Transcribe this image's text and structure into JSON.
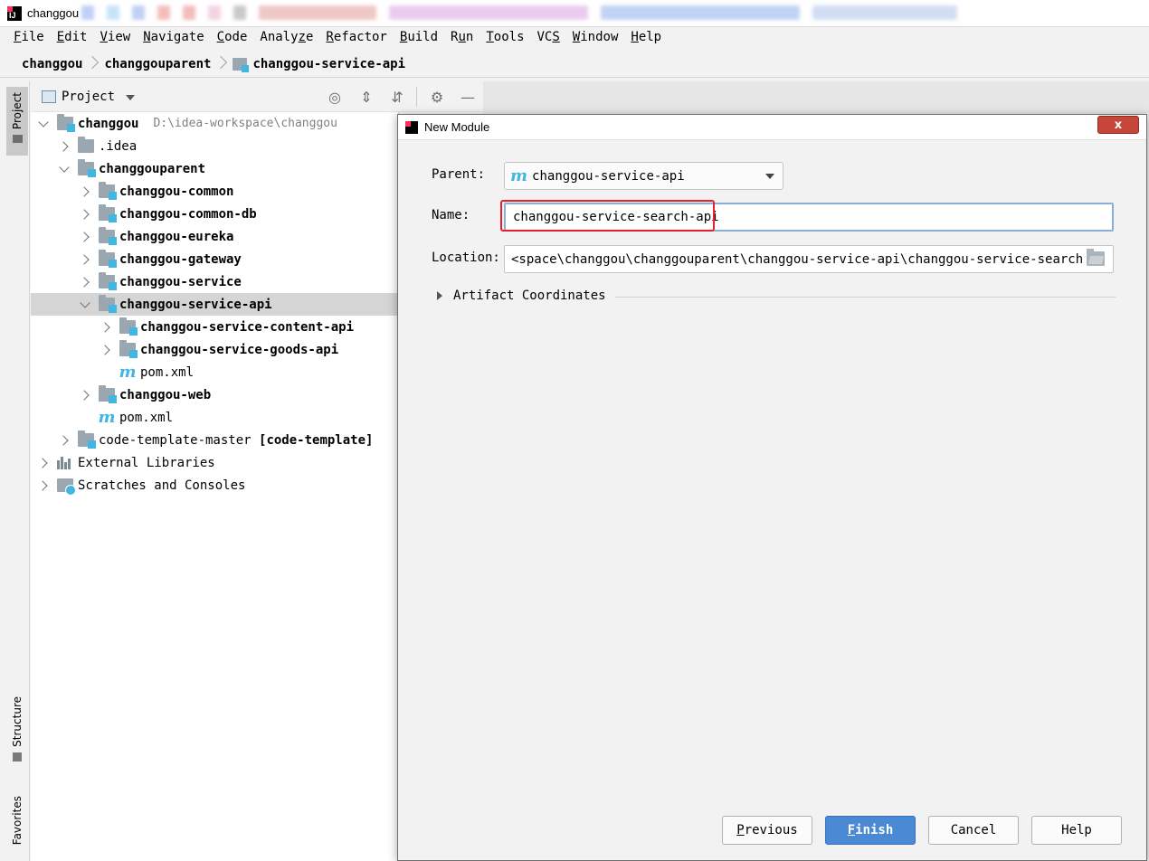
{
  "window": {
    "title": "changgou"
  },
  "menubar": [
    {
      "label": "File",
      "mnemonic": "F"
    },
    {
      "label": "Edit",
      "mnemonic": "E"
    },
    {
      "label": "View",
      "mnemonic": "V"
    },
    {
      "label": "Navigate",
      "mnemonic": "N"
    },
    {
      "label": "Code",
      "mnemonic": "C"
    },
    {
      "label": "Analyze",
      "mnemonic": "z"
    },
    {
      "label": "Refactor",
      "mnemonic": "R"
    },
    {
      "label": "Build",
      "mnemonic": "B"
    },
    {
      "label": "Run",
      "mnemonic": "u"
    },
    {
      "label": "Tools",
      "mnemonic": "T"
    },
    {
      "label": "VCS",
      "mnemonic": "S"
    },
    {
      "label": "Window",
      "mnemonic": "W"
    },
    {
      "label": "Help",
      "mnemonic": "H"
    }
  ],
  "breadcrumb": [
    "changgou",
    "changgouparent",
    "changgou-service-api"
  ],
  "left_stripe": {
    "project": "Project",
    "structure": "Structure",
    "favorites": "Favorites"
  },
  "project_panel": {
    "title": "Project",
    "tree": [
      {
        "label": "changgou",
        "path": "D:\\idea-workspace\\changgou",
        "depth": 0,
        "arrow": "down",
        "icon": "module",
        "bold": true
      },
      {
        "label": ".idea",
        "depth": 1,
        "arrow": "right",
        "icon": "folder"
      },
      {
        "label": "changgouparent",
        "depth": 1,
        "arrow": "down",
        "icon": "module",
        "bold": true
      },
      {
        "label": "changgou-common",
        "depth": 2,
        "arrow": "right",
        "icon": "module",
        "bold": true
      },
      {
        "label": "changgou-common-db",
        "depth": 2,
        "arrow": "right",
        "icon": "module",
        "bold": true
      },
      {
        "label": "changgou-eureka",
        "depth": 2,
        "arrow": "right",
        "icon": "module",
        "bold": true
      },
      {
        "label": "changgou-gateway",
        "depth": 2,
        "arrow": "right",
        "icon": "module",
        "bold": true
      },
      {
        "label": "changgou-service",
        "depth": 2,
        "arrow": "right",
        "icon": "module",
        "bold": true
      },
      {
        "label": "changgou-service-api",
        "depth": 2,
        "arrow": "down",
        "icon": "module",
        "bold": true,
        "selected": true
      },
      {
        "label": "changgou-service-content-api",
        "depth": 3,
        "arrow": "right",
        "icon": "module",
        "bold": true
      },
      {
        "label": "changgou-service-goods-api",
        "depth": 3,
        "arrow": "right",
        "icon": "module",
        "bold": true
      },
      {
        "label": "pom.xml",
        "depth": 3,
        "arrow": "none",
        "icon": "maven"
      },
      {
        "label": "changgou-web",
        "depth": 2,
        "arrow": "right",
        "icon": "module",
        "bold": true
      },
      {
        "label": "pom.xml",
        "depth": 2,
        "arrow": "none",
        "icon": "maven"
      },
      {
        "label": "code-template-master [code-template]",
        "depth": 1,
        "arrow": "right",
        "icon": "module",
        "bold": true,
        "bold_part": "[code-template]"
      },
      {
        "label": "External Libraries",
        "depth": 0,
        "arrow": "right",
        "icon": "libs"
      },
      {
        "label": "Scratches and Consoles",
        "depth": 0,
        "arrow": "right",
        "icon": "scratch"
      }
    ]
  },
  "dialog": {
    "title": "New Module",
    "close": "x",
    "parent_label": "Parent:",
    "parent_value": "changgou-service-api",
    "name_label": "Name:",
    "name_value": "changgou-service-search-api",
    "location_label": "Location:",
    "location_value": "<space\\changgou\\changgouparent\\changgou-service-api\\changgou-service-search-api",
    "artifact_label": "Artifact Coordinates",
    "buttons": {
      "previous": "Previous",
      "finish": "Finish",
      "cancel": "Cancel",
      "help": "Help"
    },
    "highlight_color": "#e8202a",
    "primary_color": "#4a89d4"
  }
}
